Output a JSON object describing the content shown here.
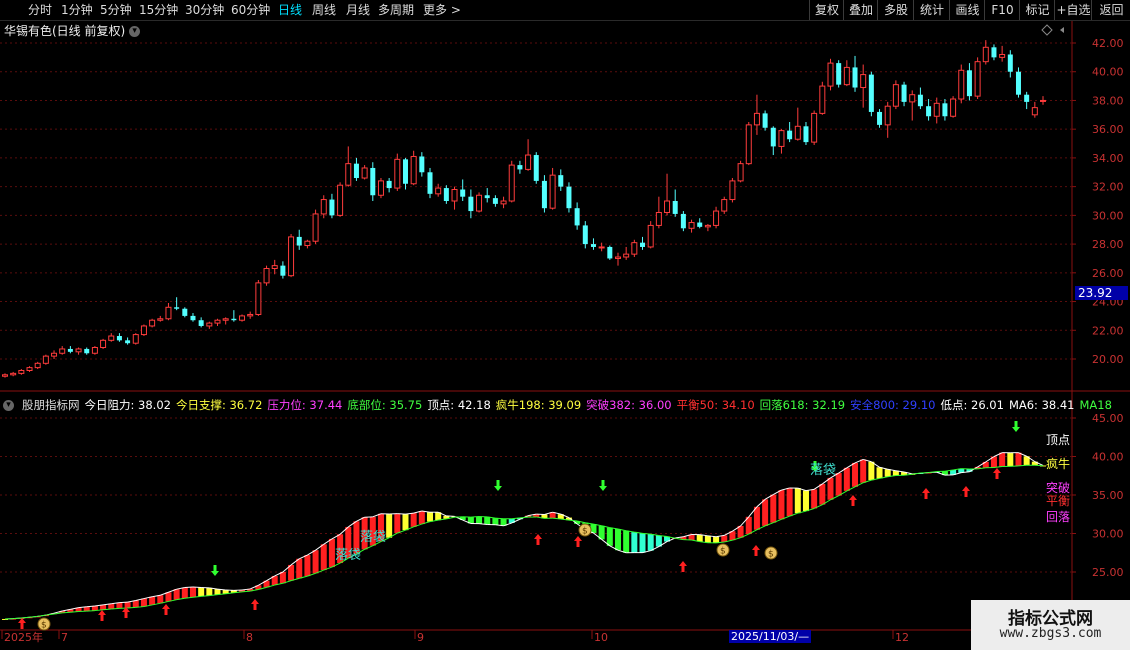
{
  "toolbar": {
    "periods": [
      "分时",
      "1分钟",
      "5分钟",
      "15分钟",
      "30分钟",
      "60分钟",
      "日线",
      "周线",
      "月线",
      "多周期",
      "更多 >"
    ],
    "active": "日线",
    "right": [
      "复权",
      "叠加",
      "多股",
      "统计",
      "画线",
      "F10",
      "标记",
      "+自选",
      "返回"
    ]
  },
  "title": "华锡有色(日线 前复权)",
  "price_axis": {
    "labels": [
      "42.00",
      "40.00",
      "38.00",
      "36.00",
      "34.00",
      "32.00",
      "30.00",
      "28.00",
      "26.00",
      "24.00",
      "22.00",
      "20.00"
    ],
    "current": "23.92"
  },
  "indicator": {
    "name": "股朋指标网",
    "items": [
      {
        "label": "今日阻力:",
        "value": "38.02",
        "color": "#ffffff"
      },
      {
        "label": "今日支撑:",
        "value": "36.72",
        "color": "#ffff40"
      },
      {
        "label": "压力位:",
        "value": "37.44",
        "color": "#ff40ff"
      },
      {
        "label": "底部位:",
        "value": "35.75",
        "color": "#40ff40"
      },
      {
        "label": "顶点:",
        "value": "42.18",
        "color": "#ffffff"
      },
      {
        "label": "疯牛198:",
        "value": "39.09",
        "color": "#ffff40"
      },
      {
        "label": "突破382:",
        "value": "36.00",
        "color": "#ff40ff"
      },
      {
        "label": "平衡50:",
        "value": "34.10",
        "color": "#ff3030"
      },
      {
        "label": "回落618:",
        "value": "32.19",
        "color": "#40ff40"
      },
      {
        "label": "安全800:",
        "value": "29.10",
        "color": "#3040ff"
      },
      {
        "label": "低点:",
        "value": "26.01",
        "color": "#ffffff"
      },
      {
        "label": "MA6:",
        "value": "38.41",
        "color": "#ffffff"
      },
      {
        "label": "MA18",
        "value": "",
        "color": "#40ff40"
      }
    ],
    "axis": [
      "45.00",
      "40.00",
      "35.00",
      "30.00",
      "25.00"
    ],
    "right_labels": [
      {
        "text": "顶点",
        "color": "#ffffff"
      },
      {
        "text": "疯牛",
        "color": "#ffff40"
      },
      {
        "text": "突破",
        "color": "#ff40ff"
      },
      {
        "text": "平衡",
        "color": "#ff3030"
      },
      {
        "text": "回落",
        "color": "#ff40ff"
      }
    ],
    "annotations": [
      "落袋",
      "落袋",
      "落袋"
    ]
  },
  "dates": {
    "labels": [
      "2025年",
      "7",
      "8",
      "9",
      "10",
      "11",
      "12"
    ],
    "highlight": "2025/11/03/—"
  },
  "watermark": {
    "line1": "指标公式网",
    "line2": "www.zbgs3.com"
  },
  "chart_data": {
    "type": "candlestick",
    "y_range": [
      18.5,
      42.8
    ],
    "candles": [
      [
        18.8,
        19.0,
        18.7,
        18.9
      ],
      [
        18.9,
        19.1,
        18.8,
        19.0
      ],
      [
        19.0,
        19.3,
        18.9,
        19.2
      ],
      [
        19.2,
        19.5,
        19.1,
        19.4
      ],
      [
        19.4,
        19.8,
        19.3,
        19.7
      ],
      [
        19.7,
        20.3,
        19.6,
        20.2
      ],
      [
        20.2,
        20.6,
        20.0,
        20.4
      ],
      [
        20.4,
        20.9,
        20.3,
        20.7
      ],
      [
        20.7,
        20.9,
        20.4,
        20.5
      ],
      [
        20.5,
        20.8,
        20.3,
        20.7
      ],
      [
        20.7,
        20.8,
        20.3,
        20.4
      ],
      [
        20.4,
        20.9,
        20.3,
        20.8
      ],
      [
        20.8,
        21.4,
        20.7,
        21.3
      ],
      [
        21.3,
        21.8,
        21.2,
        21.6
      ],
      [
        21.6,
        21.8,
        21.2,
        21.3
      ],
      [
        21.3,
        21.5,
        21.0,
        21.1
      ],
      [
        21.1,
        21.8,
        21.0,
        21.7
      ],
      [
        21.7,
        22.4,
        21.6,
        22.3
      ],
      [
        22.3,
        22.8,
        22.2,
        22.7
      ],
      [
        22.7,
        23.0,
        22.6,
        22.8
      ],
      [
        22.8,
        23.9,
        22.7,
        23.6
      ],
      [
        23.6,
        24.3,
        23.4,
        23.5
      ],
      [
        23.5,
        23.6,
        22.9,
        23.0
      ],
      [
        23.0,
        23.2,
        22.6,
        22.7
      ],
      [
        22.7,
        22.9,
        22.2,
        22.3
      ],
      [
        22.3,
        22.6,
        22.1,
        22.5
      ],
      [
        22.5,
        22.8,
        22.3,
        22.7
      ],
      [
        22.7,
        22.9,
        22.4,
        22.8
      ],
      [
        22.8,
        23.4,
        22.6,
        22.7
      ],
      [
        22.7,
        23.1,
        22.6,
        23.0
      ],
      [
        23.0,
        23.3,
        22.8,
        23.1
      ],
      [
        23.1,
        25.5,
        23.0,
        25.3
      ],
      [
        25.3,
        26.5,
        25.1,
        26.3
      ],
      [
        26.3,
        26.9,
        25.9,
        26.5
      ],
      [
        26.5,
        26.8,
        25.6,
        25.8
      ],
      [
        25.8,
        28.7,
        25.7,
        28.5
      ],
      [
        28.5,
        29.0,
        27.6,
        27.9
      ],
      [
        27.9,
        28.3,
        27.7,
        28.2
      ],
      [
        28.2,
        30.4,
        28.0,
        30.1
      ],
      [
        30.1,
        31.4,
        29.8,
        31.1
      ],
      [
        31.1,
        31.5,
        29.8,
        30.0
      ],
      [
        30.0,
        32.3,
        29.9,
        32.1
      ],
      [
        32.1,
        34.8,
        32.0,
        33.6
      ],
      [
        33.6,
        34.0,
        32.4,
        32.6
      ],
      [
        32.6,
        33.5,
        32.5,
        33.3
      ],
      [
        33.3,
        33.7,
        31.0,
        31.4
      ],
      [
        31.4,
        32.6,
        31.2,
        32.4
      ],
      [
        32.4,
        32.6,
        31.6,
        31.9
      ],
      [
        31.9,
        34.3,
        31.7,
        33.9
      ],
      [
        33.9,
        34.0,
        31.8,
        32.2
      ],
      [
        32.2,
        34.5,
        32.1,
        34.1
      ],
      [
        34.1,
        34.4,
        32.7,
        33.0
      ],
      [
        33.0,
        33.3,
        31.2,
        31.5
      ],
      [
        31.5,
        32.2,
        31.3,
        31.9
      ],
      [
        31.9,
        32.1,
        30.8,
        31.0
      ],
      [
        31.0,
        32.0,
        30.4,
        31.8
      ],
      [
        31.8,
        32.5,
        31.0,
        31.3
      ],
      [
        31.3,
        31.8,
        29.8,
        30.3
      ],
      [
        30.3,
        31.6,
        30.2,
        31.4
      ],
      [
        31.4,
        31.9,
        30.9,
        31.2
      ],
      [
        31.2,
        31.4,
        30.6,
        30.8
      ],
      [
        30.8,
        31.3,
        30.5,
        31.0
      ],
      [
        31.0,
        33.8,
        30.9,
        33.5
      ],
      [
        33.5,
        33.8,
        32.9,
        33.2
      ],
      [
        33.2,
        35.3,
        33.1,
        34.2
      ],
      [
        34.2,
        34.4,
        32.2,
        32.4
      ],
      [
        32.4,
        32.8,
        30.2,
        30.5
      ],
      [
        30.5,
        33.3,
        30.4,
        32.8
      ],
      [
        32.8,
        33.2,
        31.7,
        32.0
      ],
      [
        32.0,
        32.3,
        30.2,
        30.5
      ],
      [
        30.5,
        30.9,
        29.0,
        29.3
      ],
      [
        29.3,
        29.6,
        27.7,
        28.0
      ],
      [
        28.0,
        28.4,
        27.6,
        27.8
      ],
      [
        27.8,
        28.1,
        27.5,
        27.8
      ],
      [
        27.8,
        27.9,
        26.9,
        27.0
      ],
      [
        27.0,
        27.4,
        26.5,
        27.1
      ],
      [
        27.1,
        27.8,
        26.9,
        27.3
      ],
      [
        27.3,
        28.3,
        27.1,
        28.1
      ],
      [
        28.1,
        28.5,
        27.6,
        27.8
      ],
      [
        27.8,
        29.6,
        27.7,
        29.3
      ],
      [
        29.3,
        31.3,
        29.1,
        30.2
      ],
      [
        30.2,
        32.9,
        30.0,
        31.0
      ],
      [
        31.0,
        31.8,
        29.9,
        30.1
      ],
      [
        30.1,
        30.3,
        28.9,
        29.1
      ],
      [
        29.1,
        29.7,
        28.8,
        29.5
      ],
      [
        29.5,
        29.8,
        29.1,
        29.2
      ],
      [
        29.2,
        29.4,
        28.9,
        29.3
      ],
      [
        29.3,
        30.6,
        29.1,
        30.3
      ],
      [
        30.3,
        31.3,
        30.1,
        31.1
      ],
      [
        31.1,
        32.6,
        30.9,
        32.4
      ],
      [
        32.4,
        33.8,
        32.3,
        33.6
      ],
      [
        33.6,
        36.5,
        33.5,
        36.3
      ],
      [
        36.3,
        38.4,
        35.6,
        37.1
      ],
      [
        37.1,
        37.3,
        35.9,
        36.1
      ],
      [
        36.1,
        36.2,
        34.2,
        34.8
      ],
      [
        34.8,
        36.0,
        34.3,
        35.9
      ],
      [
        35.9,
        36.5,
        35.1,
        35.3
      ],
      [
        35.3,
        37.5,
        35.2,
        36.2
      ],
      [
        36.2,
        36.5,
        34.9,
        35.1
      ],
      [
        35.1,
        37.3,
        34.9,
        37.1
      ],
      [
        37.1,
        39.3,
        37.0,
        39.0
      ],
      [
        39.0,
        40.9,
        38.7,
        40.6
      ],
      [
        40.6,
        40.8,
        38.9,
        39.1
      ],
      [
        39.1,
        40.8,
        39.0,
        40.3
      ],
      [
        40.3,
        41.1,
        38.6,
        38.9
      ],
      [
        38.9,
        40.5,
        37.5,
        39.8
      ],
      [
        39.8,
        40.0,
        36.9,
        37.2
      ],
      [
        37.2,
        37.4,
        36.1,
        36.3
      ],
      [
        36.3,
        37.9,
        35.4,
        37.6
      ],
      [
        37.6,
        39.4,
        37.4,
        39.1
      ],
      [
        39.1,
        39.3,
        37.6,
        37.9
      ],
      [
        37.9,
        38.7,
        36.6,
        38.4
      ],
      [
        38.4,
        38.9,
        37.4,
        37.6
      ],
      [
        37.6,
        38.1,
        36.6,
        36.9
      ],
      [
        36.9,
        38.2,
        36.4,
        37.8
      ],
      [
        37.8,
        38.1,
        36.6,
        36.9
      ],
      [
        36.9,
        38.3,
        36.8,
        38.1
      ],
      [
        38.1,
        40.5,
        37.8,
        40.1
      ],
      [
        40.1,
        40.6,
        38.0,
        38.3
      ],
      [
        38.3,
        41.0,
        38.1,
        40.7
      ],
      [
        40.7,
        42.2,
        40.5,
        41.7
      ],
      [
        41.7,
        41.9,
        40.8,
        41.0
      ],
      [
        41.0,
        41.8,
        40.7,
        41.2
      ],
      [
        41.2,
        41.5,
        39.6,
        40.0
      ],
      [
        40.0,
        40.3,
        38.2,
        38.4
      ],
      [
        38.4,
        38.6,
        37.4,
        37.9
      ],
      [
        37.0,
        37.9,
        36.8,
        37.5
      ],
      [
        38.0,
        38.3,
        37.7,
        38.0
      ]
    ]
  }
}
